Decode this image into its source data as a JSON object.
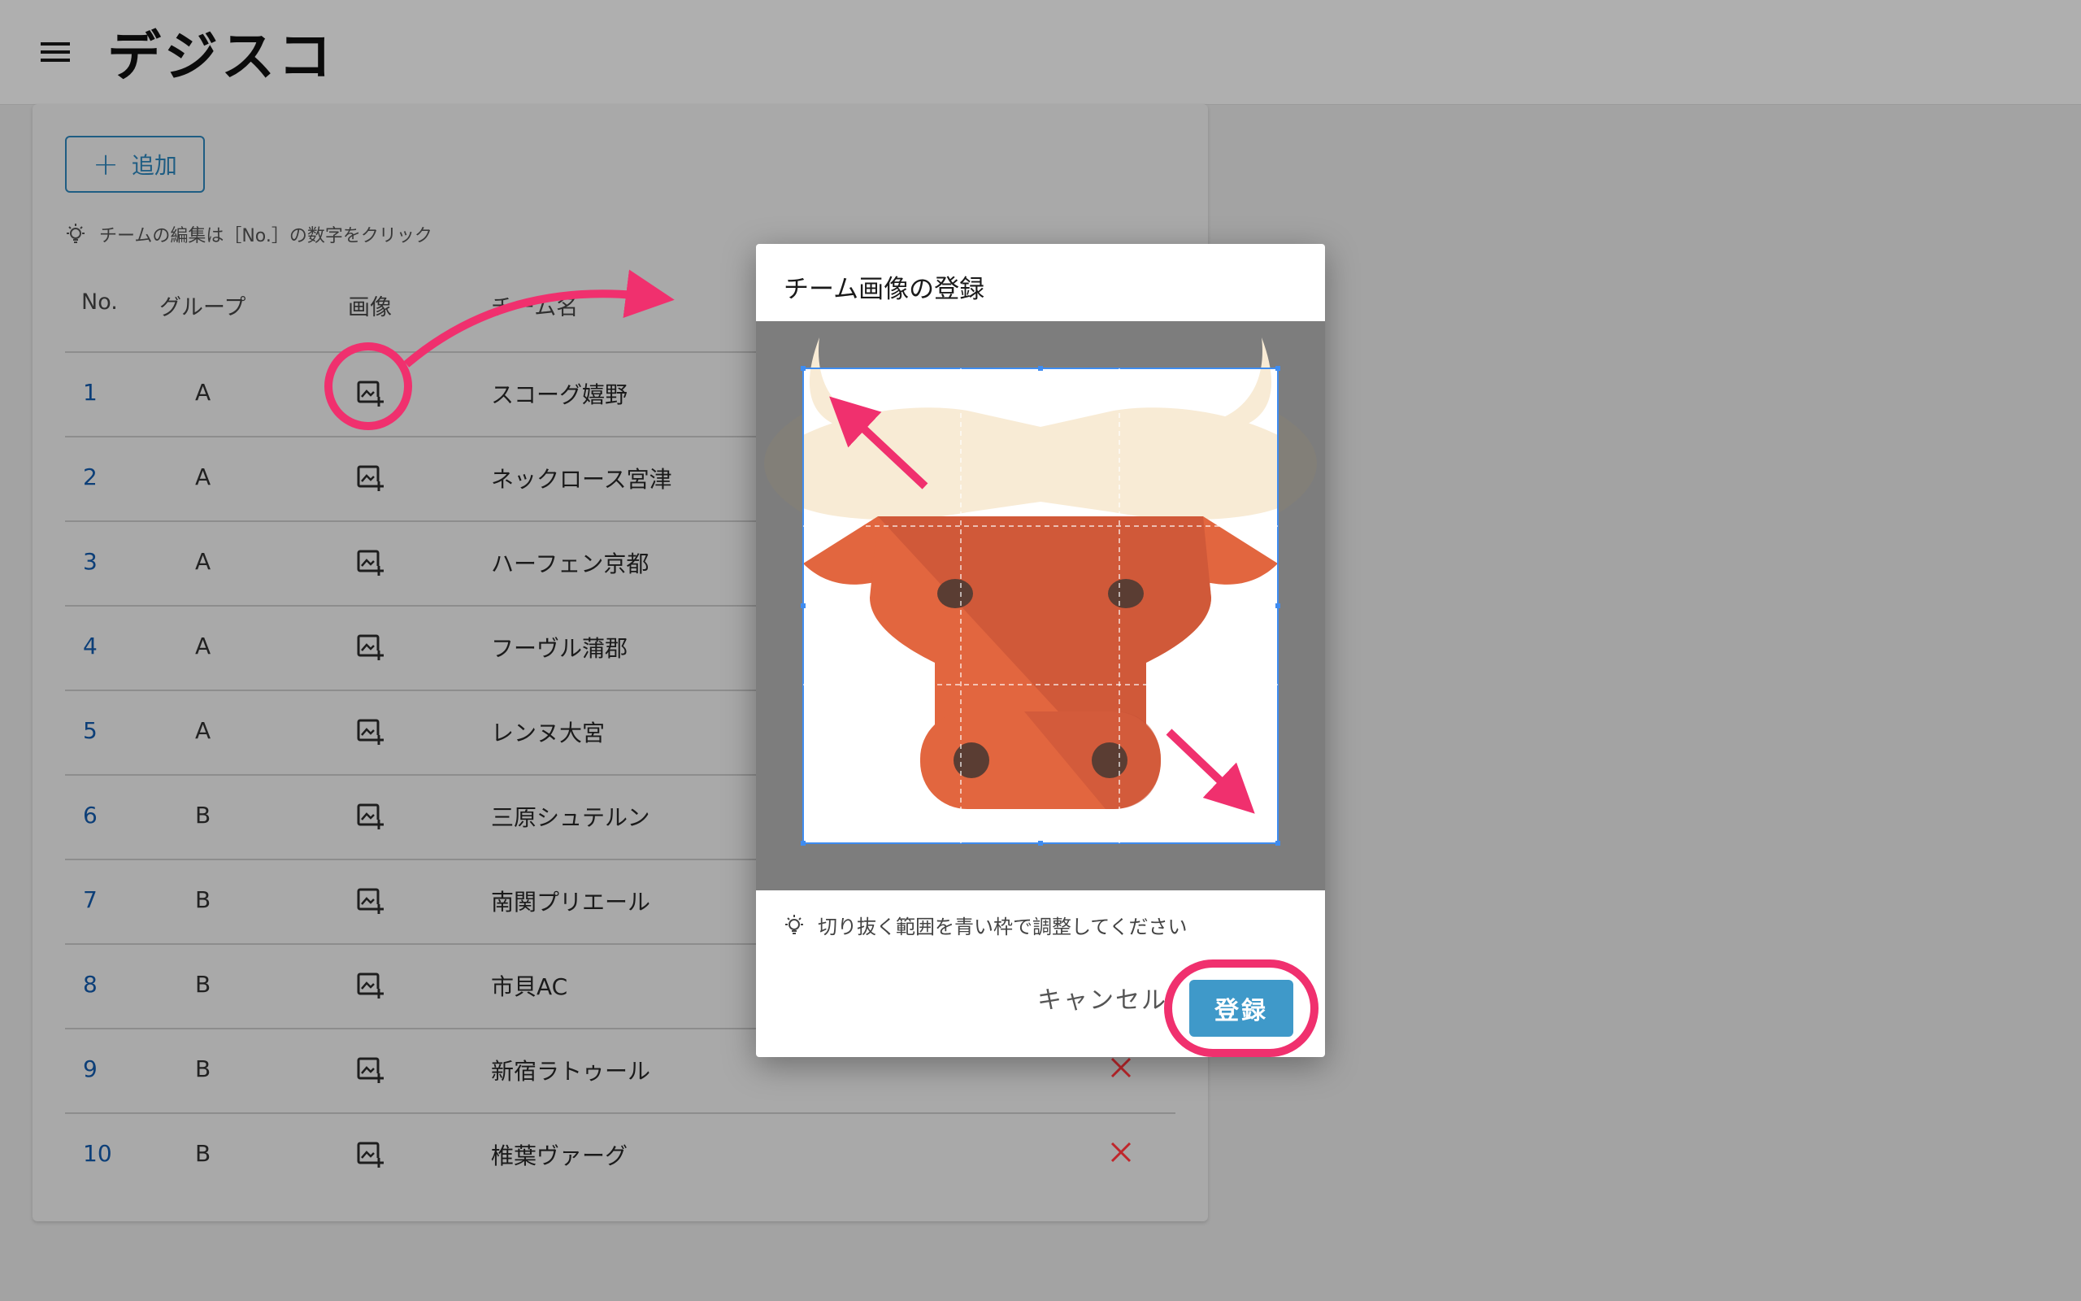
{
  "app": {
    "logo_text": "デジスコ"
  },
  "toolbar": {
    "add_label": "追加",
    "hint": "チームの編集は［No.］の数字をクリック"
  },
  "table": {
    "headers": {
      "no": "No.",
      "group": "グループ",
      "image": "画像",
      "name": "チーム名"
    },
    "rows": [
      {
        "no": "1",
        "group": "A",
        "name": "スコーグ嬉野"
      },
      {
        "no": "2",
        "group": "A",
        "name": "ネックロース宮津"
      },
      {
        "no": "3",
        "group": "A",
        "name": "ハーフェン京都"
      },
      {
        "no": "4",
        "group": "A",
        "name": "フーヴル蒲郡"
      },
      {
        "no": "5",
        "group": "A",
        "name": "レンヌ大宮"
      },
      {
        "no": "6",
        "group": "B",
        "name": "三原シュテルン"
      },
      {
        "no": "7",
        "group": "B",
        "name": "南関プリエール"
      },
      {
        "no": "8",
        "group": "B",
        "name": "市貝AC"
      },
      {
        "no": "9",
        "group": "B",
        "name": "新宿ラトゥール"
      },
      {
        "no": "10",
        "group": "B",
        "name": "椎葉ヴァーグ"
      }
    ]
  },
  "modal": {
    "title": "チーム画像の登録",
    "hint": "切り抜く範囲を青い枠で調整してください",
    "cancel_label": "キャンセル",
    "register_label": "登録"
  },
  "colors": {
    "accent": "#3f99c9",
    "annotation": "#f0306e",
    "delete": "#c0262b",
    "link": "#0d3f78",
    "crop_frame": "#3f8cf0"
  }
}
